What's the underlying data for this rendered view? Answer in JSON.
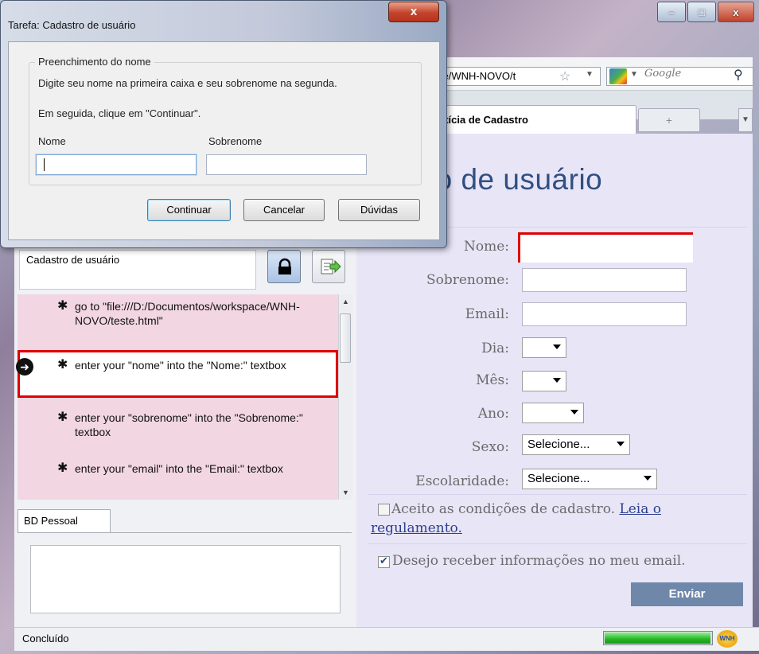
{
  "dialog": {
    "title": "Tarefa: Cadastro de usuário",
    "close_label": "x",
    "group_label": "Preenchimento do nome",
    "instruction1": "Digite seu nome na primeira caixa e seu sobrenome na segunda.",
    "instruction2": "Em seguida, clique em \"Continuar\".",
    "field_nome_label": "Nome",
    "field_nome_value": "",
    "field_sobrenome_label": "Sobrenome",
    "field_sobrenome_value": "",
    "buttons": {
      "continuar": "Continuar",
      "cancelar": "Cancelar",
      "duvidas": "Dúvidas"
    }
  },
  "browser": {
    "window_controls": [
      "–",
      "□",
      "x"
    ],
    "url": "ce/WNH-NOVO/t",
    "search_placeholder": "Google",
    "tab_label": "ctícia de Cadastro",
    "new_tab_label": "+",
    "status_text": "Concluído",
    "progress_percent": 100,
    "addon_label": "WNH"
  },
  "sidebar": {
    "script_title": "Cadastro de usuário",
    "steps": [
      {
        "text": "go to \"file:///D:/Documentos/workspace/WNH-NOVO/teste.html\"",
        "current": false
      },
      {
        "text": "enter your \"nome\" into the \"Nome:\" textbox",
        "current": true
      },
      {
        "text": "enter your \"sobrenome\" into the \"Sobrenome:\" textbox",
        "current": false
      },
      {
        "text": "enter your \"email\" into the \"Email:\" textbox",
        "current": false
      }
    ],
    "bottom_tab": "BD Pessoal"
  },
  "form": {
    "title": "stro de usuário",
    "labels": {
      "nome": "Nome:",
      "sobrenome": "Sobrenome:",
      "email": "Email:",
      "dia": "Dia:",
      "mes": "Mês:",
      "ano": "Ano:",
      "sexo": "Sexo:",
      "escolaridade": "Escolaridade:"
    },
    "values": {
      "nome": "",
      "sobrenome": "",
      "email": "",
      "dia": "",
      "mes": "",
      "ano": "",
      "sexo": "Selecione...",
      "escolaridade": "Selecione..."
    },
    "terms_text": "Aceito as condições de cadastro.",
    "terms_link_1": "Leia o",
    "terms_link_2": "regulamento.",
    "terms_checked": false,
    "newsletter_text": "Desejo receber informações no meu email.",
    "newsletter_checked": true,
    "submit_label": "Enviar"
  }
}
